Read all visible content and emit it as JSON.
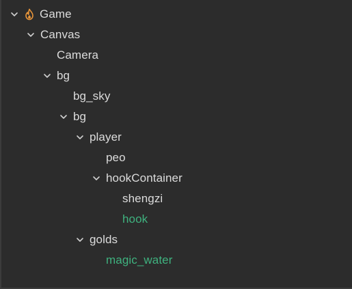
{
  "hierarchy": {
    "accent_color": "#e8953a",
    "prefab_color": "#3fb27f",
    "text_color": "#dcdcdc",
    "nodes": [
      {
        "label": "Game",
        "depth": 0,
        "expanded": true,
        "icon": "fire-icon",
        "prefab": false
      },
      {
        "label": "Canvas",
        "depth": 1,
        "expanded": true,
        "prefab": false
      },
      {
        "label": "Camera",
        "depth": 2,
        "expanded": null,
        "prefab": false
      },
      {
        "label": "bg",
        "depth": 2,
        "expanded": true,
        "prefab": false
      },
      {
        "label": "bg_sky",
        "depth": 3,
        "expanded": null,
        "prefab": false
      },
      {
        "label": "bg",
        "depth": 3,
        "expanded": true,
        "prefab": false
      },
      {
        "label": "player",
        "depth": 4,
        "expanded": true,
        "prefab": false
      },
      {
        "label": "peo",
        "depth": 5,
        "expanded": null,
        "prefab": false
      },
      {
        "label": "hookContainer",
        "depth": 5,
        "expanded": true,
        "prefab": false
      },
      {
        "label": "shengzi",
        "depth": 6,
        "expanded": null,
        "prefab": false
      },
      {
        "label": "hook",
        "depth": 6,
        "expanded": null,
        "prefab": true
      },
      {
        "label": "golds",
        "depth": 4,
        "expanded": true,
        "prefab": false
      },
      {
        "label": "magic_water",
        "depth": 5,
        "expanded": null,
        "prefab": true
      }
    ]
  }
}
